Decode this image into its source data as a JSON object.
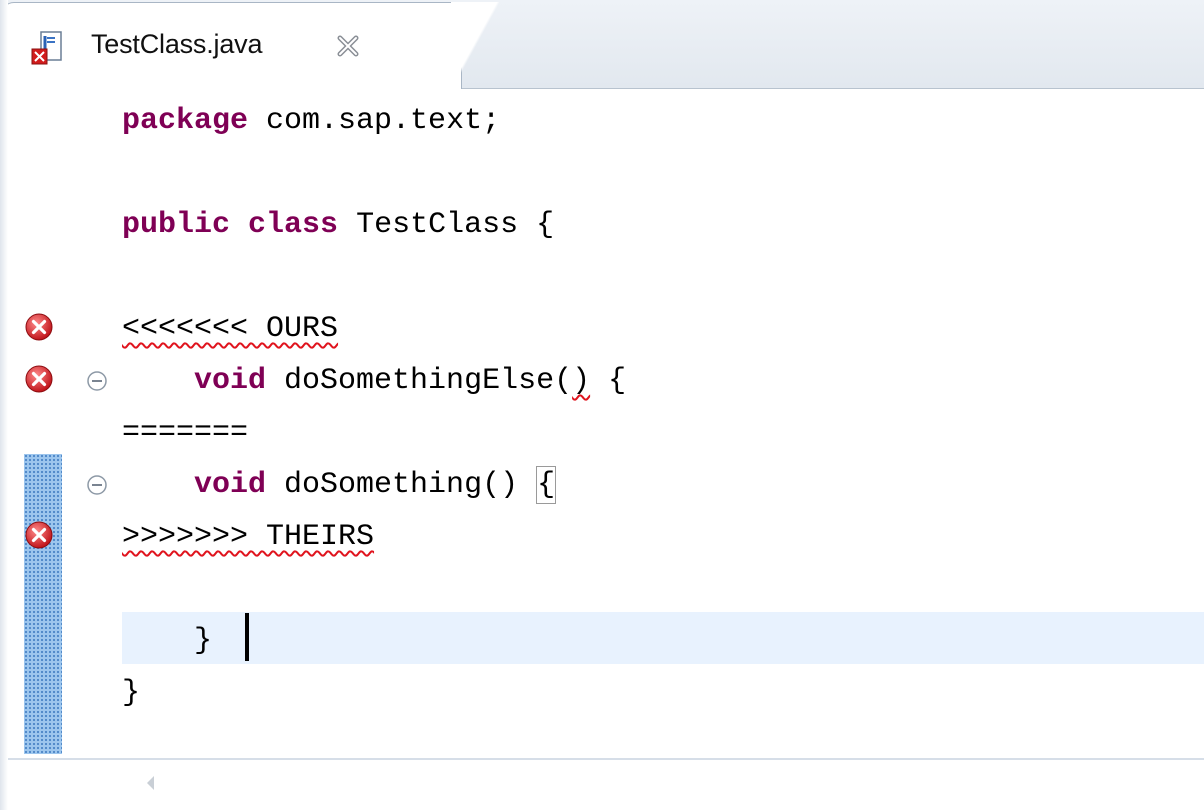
{
  "tab": {
    "label": "TestClass.java",
    "icon": "java-file-error-icon",
    "close_icon": "close-icon"
  },
  "code": {
    "line1": {
      "keyword": "package",
      "rest": " com.sap.text;"
    },
    "line3": {
      "keyword1": "public",
      "keyword2": "class",
      "rest": " TestClass {"
    },
    "line5": {
      "text": "<<<<<<< OURS"
    },
    "line6": {
      "indent": "    ",
      "keyword": "void",
      "name": " doSomethingElse(",
      "paren_close": ")",
      "rest": " {"
    },
    "line7": {
      "text": "======="
    },
    "line8": {
      "indent": "    ",
      "keyword": "void",
      "name": " doSomething() ",
      "bracket": "{"
    },
    "line9": {
      "text": ">>>>>>> THEIRS"
    },
    "line11": {
      "text": "    }"
    },
    "line12": {
      "text": "}"
    }
  },
  "markers": {
    "error_icon": "error-icon",
    "fold_icon": "collapse-icon",
    "scroll_icon": "scroll-left-icon"
  },
  "colors": {
    "keyword": "#7f0055",
    "error_underline": "#e0141e",
    "current_line": "#e8f2fe",
    "change_bar": "#9dc6ee"
  }
}
